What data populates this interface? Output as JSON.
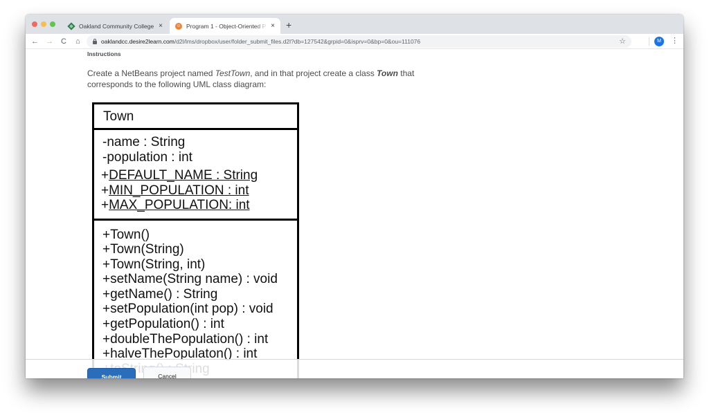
{
  "browser": {
    "tabs": [
      {
        "title": "Oakland Community College",
        "favicon": "oakland-diamond-icon",
        "active": false
      },
      {
        "title": "Program 1 - Object-Oriented P",
        "favicon": "d2l-orange-icon",
        "active": true
      }
    ],
    "new_tab_label": "+",
    "close_glyph": "×",
    "nav": {
      "back": "←",
      "forward": "→",
      "reload": "C",
      "home": "⌂"
    },
    "url": {
      "host": "oaklandcc.desire2learn.com",
      "path": "/d2l/lms/dropbox/user/folder_submit_files.d2l?db=127542&grpid=0&isprv=0&bp=0&ou=111076"
    },
    "bookmark_glyph": "☆",
    "profile_initial": "M",
    "menu_glyph": "⋮"
  },
  "page": {
    "section_label": "Instructions",
    "instructions": {
      "part1": "Create a NetBeans project named ",
      "project_name": "TestTown",
      "part2": ", and in that project create a class ",
      "class_name": "Town",
      "part3": " that corresponds to the following UML class  diagram:"
    },
    "uml": {
      "class_name": "Town",
      "attributes": [
        {
          "prefix": "",
          "text": "-name : String",
          "static": false
        },
        {
          "prefix": "",
          "text": "-population : int",
          "static": false
        }
      ],
      "static_attributes": [
        {
          "prefix": "+",
          "text": "DEFAULT_NAME : String"
        },
        {
          "prefix": "+",
          "text": "MIN_POPULATION : int"
        },
        {
          "prefix": "+",
          "text": "MAX_POPULATION: int"
        }
      ],
      "methods": [
        "+Town()",
        "+Town(String)",
        "+Town(String, int)",
        "+setName(String name) : void",
        "+getName() : String",
        "+setPopulation(int pop) : void",
        "+getPopulation() : int",
        "+doubleThePopulation() : int",
        "+halveThePopulaton() : int",
        "+toString() : String"
      ]
    }
  },
  "footer": {
    "submit_label": "Submit",
    "cancel_label": "Cancel"
  }
}
